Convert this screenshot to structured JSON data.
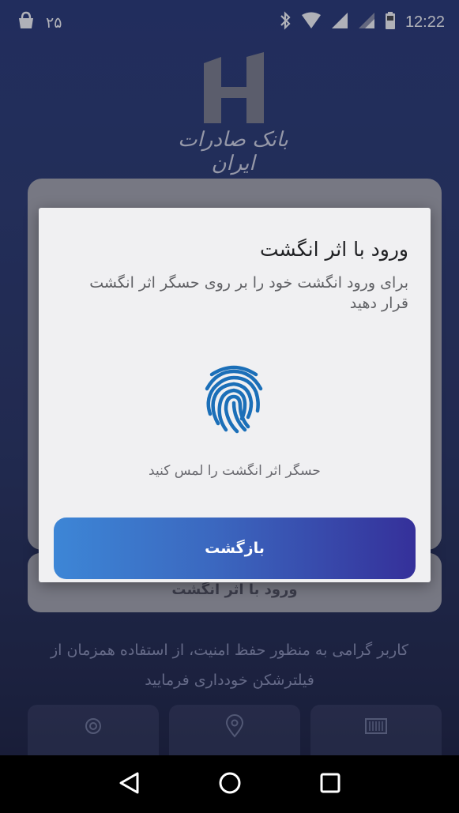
{
  "status_bar": {
    "notification_count": "۲۵",
    "time": "12:22",
    "icons": [
      "shopping-bag-icon",
      "bluetooth-icon",
      "wifi-icon",
      "signal-icon",
      "signal-icon-2",
      "battery-icon"
    ]
  },
  "logo": {
    "text": "بانک صادرات ایران",
    "color": "#7d7f8a"
  },
  "background": {
    "fingerprint_login_button_label": "ورود با اثر انگشت",
    "security_notice": "کاربر گرامی به منظور حفظ امنیت، از استفاده همزمان از فیلترشکن خودداری فرمایید",
    "tiles": [
      {
        "icon": "gear-icon"
      },
      {
        "icon": "location-pin-icon"
      },
      {
        "icon": "barcode-icon"
      }
    ]
  },
  "dialog": {
    "title": "ورود با اثر انگشت",
    "description": "برای ورود انگشت خود را بر روی حسگر اثر انگشت قرار دهید",
    "hint": "حسگر اثر انگشت را لمس کنید",
    "icon": "fingerprint-icon",
    "icon_color": "#1b6fb8"
  },
  "back_button": {
    "label": "بازگشت"
  },
  "nav_bar": {
    "icons": [
      "back-triangle-icon",
      "home-circle-icon",
      "recents-square-icon"
    ]
  }
}
